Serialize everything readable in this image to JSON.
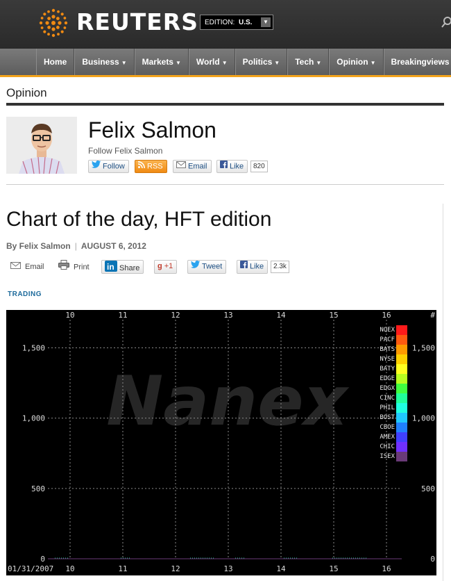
{
  "header": {
    "logo_text": "REUTERS",
    "edition_label": "EDITION:",
    "edition_value": "U.S.",
    "brand_color": "#f2a31b"
  },
  "nav": {
    "items": [
      {
        "label": "Home",
        "has_menu": false
      },
      {
        "label": "Business",
        "has_menu": true
      },
      {
        "label": "Markets",
        "has_menu": true
      },
      {
        "label": "World",
        "has_menu": true
      },
      {
        "label": "Politics",
        "has_menu": true
      },
      {
        "label": "Tech",
        "has_menu": true
      },
      {
        "label": "Opinion",
        "has_menu": true
      },
      {
        "label": "Breakingviews",
        "has_menu": true
      }
    ]
  },
  "section": {
    "title": "Opinion"
  },
  "author": {
    "name": "Felix Salmon",
    "follow_text": "Follow Felix Salmon",
    "buttons": {
      "follow": "Follow",
      "rss": "RSS",
      "email": "Email",
      "like": "Like",
      "like_count": "820"
    }
  },
  "article": {
    "headline": "Chart of the day, HFT edition",
    "byline": "By Felix Salmon",
    "date": "AUGUST 6, 2012",
    "share": {
      "email": "Email",
      "print": "Print",
      "share": "Share",
      "plus_one": "+1",
      "tweet": "Tweet",
      "like": "Like",
      "like_count": "2.3k"
    },
    "tag": "TRADING"
  },
  "chart_data": {
    "type": "area",
    "watermark": "Nanex",
    "date_label": "01/31/2007",
    "x_ticks": [
      "10",
      "11",
      "12",
      "13",
      "14",
      "15",
      "16"
    ],
    "y_ticks": [
      "0",
      "500",
      "1,000",
      "1,500"
    ],
    "y_right_header": "#",
    "ylim": [
      0,
      1700
    ],
    "grid": true,
    "legend_placement": "right",
    "series": [
      {
        "name": "NQEX",
        "color": "#ff1a1a"
      },
      {
        "name": "PACF",
        "color": "#ff5a10"
      },
      {
        "name": "BATS",
        "color": "#ff9a00"
      },
      {
        "name": "NYSE",
        "color": "#ffd000"
      },
      {
        "name": "BATY",
        "color": "#ffff20"
      },
      {
        "name": "EDGE",
        "color": "#b8ff20"
      },
      {
        "name": "EDGX",
        "color": "#40ff40"
      },
      {
        "name": "CINC",
        "color": "#20ff9a"
      },
      {
        "name": "PHIL",
        "color": "#20ffe0"
      },
      {
        "name": "BOST",
        "color": "#20c8ff"
      },
      {
        "name": "CBOE",
        "color": "#2080ff"
      },
      {
        "name": "AMEX",
        "color": "#4040ff"
      },
      {
        "name": "CHIC",
        "color": "#7030ff"
      },
      {
        "name": "ISEX",
        "color": "#6a3a78"
      }
    ]
  }
}
